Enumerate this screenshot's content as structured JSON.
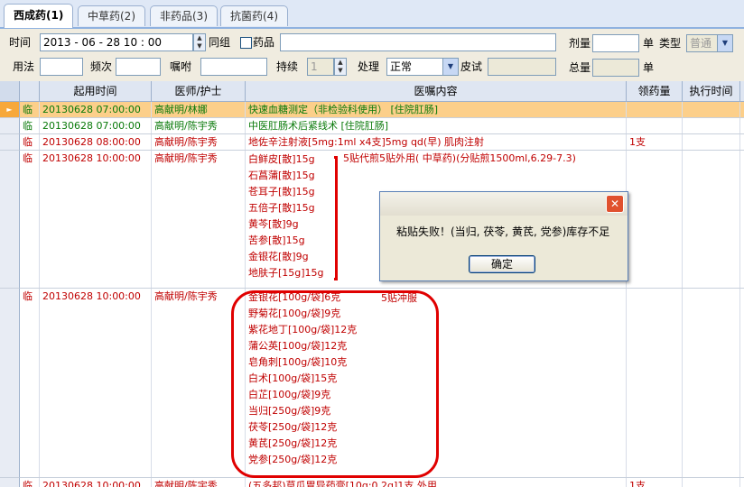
{
  "tabs": [
    "西成药(1)",
    "中草药(2)",
    "非药品(3)",
    "抗菌药(4)"
  ],
  "form": {
    "time_label": "时间",
    "time_value": "2013 - 06 - 28    10 : 00",
    "same_group_label": "同组",
    "drug_label": "药品",
    "dose_label": "剂量",
    "unit1": "单",
    "type_label": "类型",
    "type_value": "普通",
    "usage_label": "用法",
    "freq_label": "频次",
    "note_label": "嘱咐",
    "duration_label": "持续",
    "duration_value": "1",
    "handle_label": "处理",
    "handle_value": "正常",
    "skin_test_label": "皮试",
    "total_label": "总量",
    "unit2": "单"
  },
  "grid": {
    "columns": [
      "起用时间",
      "医师/护士",
      "医嘱内容",
      "领药量",
      "执行时间"
    ],
    "rows": [
      {
        "kind": "临",
        "time": "20130628 07:00:00",
        "doctor": "高献明/林娜",
        "content": "快速血糖测定（非检验科使用）  [住院肛肠]",
        "qty": "",
        "color": "green",
        "selected": true
      },
      {
        "kind": "临",
        "time": "20130628 07:00:00",
        "doctor": "高献明/陈宇秀",
        "content": "中医肛肠术后紧线术   [住院肛肠]",
        "qty": "",
        "color": "green"
      },
      {
        "kind": "临",
        "time": "20130628 08:00:00",
        "doctor": "高献明/陈宇秀",
        "content": "地佐辛注射液[5mg:1ml x4支]5mg  qd(早) 肌肉注射",
        "qty": "1支",
        "color": "red"
      },
      {
        "kind": "临",
        "time": "20130628 10:00:00",
        "doctor": "高献明/陈宇秀",
        "drugs": [
          "白鲜皮[散]15g",
          "石菖蒲[散]15g",
          "苍耳子[散]15g",
          "五倍子[散]15g",
          "黄芩[散]9g",
          "苦参[散]15g",
          "金银花[散]9g",
          "地肤子[15g]15g"
        ],
        "note": "5贴代煎5贴外用( 中草药)(分贴煎1500ml,6.29-7.3)",
        "qty": "",
        "color": "red"
      },
      {
        "kind": "临",
        "time": "20130628 10:00:00",
        "doctor": "高献明/陈宇秀",
        "drugs": [
          "金银花[100g/袋]6克",
          "野菊花[100g/袋]9克",
          "紫花地丁[100g/袋]12克",
          "蒲公英[100g/袋]12克",
          "皂角刺[100g/袋]10克",
          "白术[100g/袋]15克",
          "白芷[100g/袋]9克",
          "当归[250g/袋]9克",
          "茯苓[250g/袋]12克",
          "黄芪[250g/袋]12克",
          "党参[250g/袋]12克"
        ],
        "note": "5贴冲服",
        "qty": "",
        "color": "red"
      },
      {
        "kind": "临",
        "time": "20130628 10:00:00",
        "doctor": "高献明/陈宇秀",
        "content": "(五多邦)草瓜胃异药膏[10g:0.2g]1支   外用",
        "qty": "1支",
        "color": "red"
      }
    ]
  },
  "dialog": {
    "close_symbol": "✕",
    "message": "粘贴失败！(当归, 茯苓, 黄芪, 党参)库存不足",
    "ok_label": "确定"
  }
}
